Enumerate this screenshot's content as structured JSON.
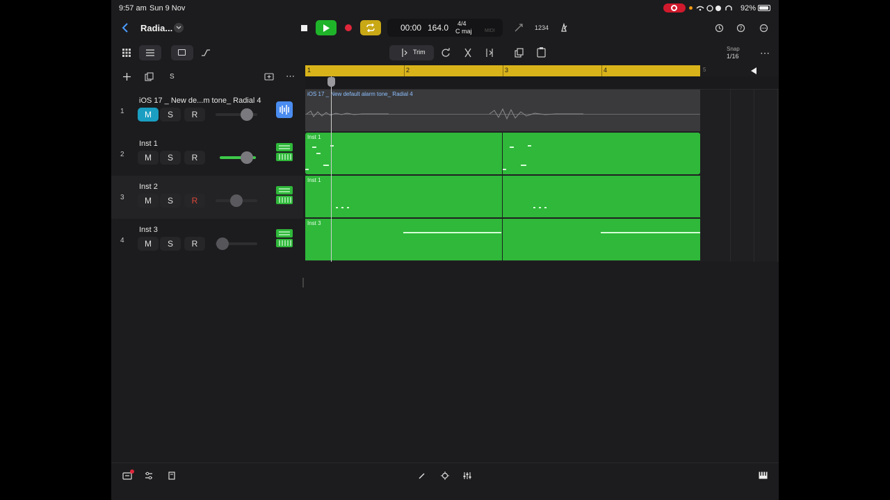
{
  "status_bar": {
    "time": "9:57 am",
    "date": "Sun 9 Nov",
    "battery": "92%"
  },
  "header": {
    "back_icon": "chevron-left-icon",
    "project_title": "Radia...",
    "title_menu_icon": "chevron-down-icon"
  },
  "transport": {
    "stop_icon": "stop-icon",
    "play_icon": "play-icon",
    "record_icon": "record-icon",
    "cycle_icon": "cycle-icon",
    "time": "00:00",
    "tempo": "164.0",
    "signature": "4/4",
    "key": "C maj",
    "midi": "MIDI",
    "count_in": "1234",
    "accent_play": "#1fb32a",
    "accent_cycle": "#c9a816",
    "accent_record": "#e0263a"
  },
  "toolbar": {
    "trim_label": "Trim",
    "snap_label": "Snap",
    "snap_value": "1/16"
  },
  "track_header_toolbar": {
    "add_icon": "plus-icon",
    "duplicate_icon": "duplicate-icon",
    "s_label": "S",
    "more_icon": "ellipsis-icon"
  },
  "tracks": [
    {
      "number": "1",
      "name": "iOS 17 _ New de...m tone_ Radial 4",
      "m": "M",
      "s": "S",
      "r": "R",
      "muted": true,
      "type": "audio"
    },
    {
      "number": "2",
      "name": "Inst 1",
      "m": "M",
      "s": "S",
      "r": "R",
      "muted": false,
      "type": "instrument"
    },
    {
      "number": "3",
      "name": "Inst 2",
      "m": "M",
      "s": "S",
      "r": "R",
      "muted": false,
      "type": "instrument"
    },
    {
      "number": "4",
      "name": "Inst 3",
      "m": "M",
      "s": "S",
      "r": "R",
      "muted": false,
      "type": "instrument"
    }
  ],
  "ruler": {
    "bars": [
      "1",
      "2",
      "3",
      "4",
      "5"
    ],
    "accent": "#d9b31a"
  },
  "regions": [
    {
      "label": "iOS 17 _ New default alarm tone_ Radial 4"
    },
    {
      "label": "Inst 1"
    },
    {
      "label": "Inst 1"
    },
    {
      "label": "Inst 3"
    }
  ],
  "region_color": "#2fb83a"
}
